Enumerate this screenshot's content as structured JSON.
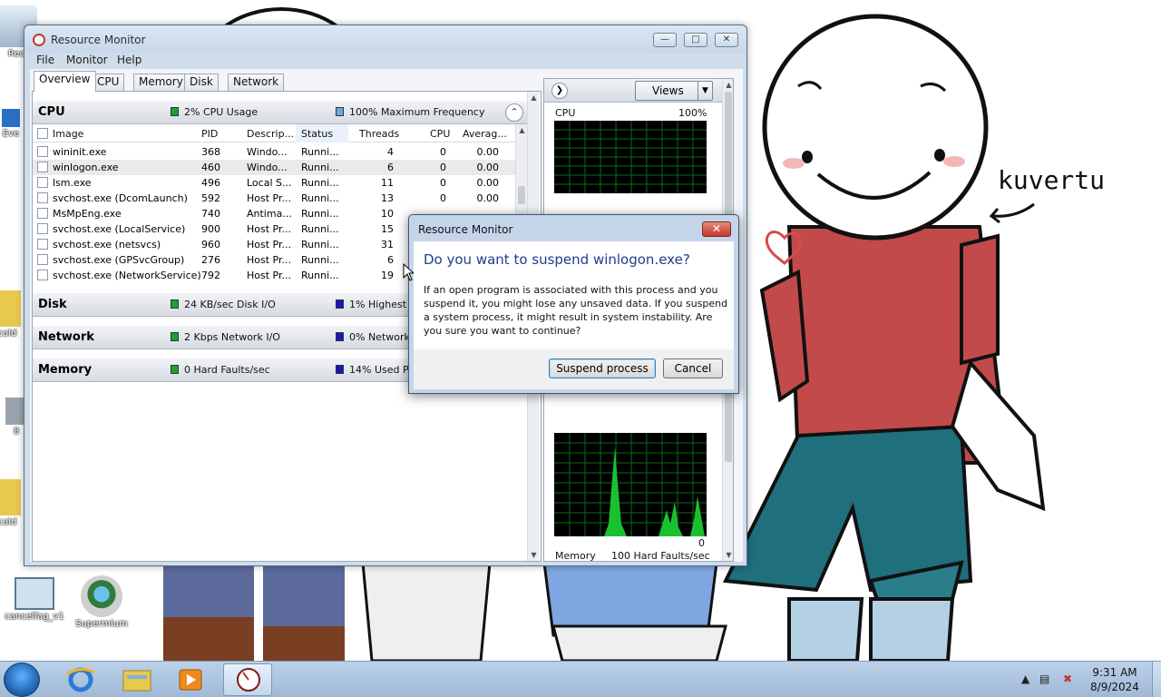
{
  "desktop": {
    "icons": [
      {
        "label": "Rec"
      },
      {
        "label": "Eve"
      },
      {
        "label": "cald"
      },
      {
        "label": "8"
      },
      {
        "label": "cald"
      },
      {
        "label": "cancelfag_v1"
      },
      {
        "label": "Supermium"
      }
    ],
    "wallpaper_text": "kuvertu"
  },
  "window": {
    "title": "Resource Monitor",
    "menu": [
      "File",
      "Monitor",
      "Help"
    ],
    "tabs": [
      "Overview",
      "CPU",
      "Memory",
      "Disk",
      "Network"
    ],
    "active_tab": "Overview",
    "cpu": {
      "title": "CPU",
      "stat1": "2% CPU Usage",
      "stat2": "100% Maximum Frequency",
      "columns": [
        "Image",
        "PID",
        "Descrip...",
        "Status",
        "Threads",
        "CPU",
        "Averag..."
      ],
      "rows": [
        {
          "image": "wininit.exe",
          "pid": "368",
          "desc": "Windo...",
          "status": "Runni...",
          "threads": "4",
          "cpu": "0",
          "avg": "0.00",
          "selected": false
        },
        {
          "image": "winlogon.exe",
          "pid": "460",
          "desc": "Windo...",
          "status": "Runni...",
          "threads": "6",
          "cpu": "0",
          "avg": "0.00",
          "selected": true
        },
        {
          "image": "lsm.exe",
          "pid": "496",
          "desc": "Local S...",
          "status": "Runni...",
          "threads": "11",
          "cpu": "0",
          "avg": "0.00",
          "selected": false
        },
        {
          "image": "svchost.exe (DcomLaunch)",
          "pid": "592",
          "desc": "Host Pr...",
          "status": "Runni...",
          "threads": "13",
          "cpu": "0",
          "avg": "0.00",
          "selected": false
        },
        {
          "image": "MsMpEng.exe",
          "pid": "740",
          "desc": "Antima...",
          "status": "Runni...",
          "threads": "10",
          "cpu": "",
          "avg": "",
          "selected": false
        },
        {
          "image": "svchost.exe (LocalService)",
          "pid": "900",
          "desc": "Host Pr...",
          "status": "Runni...",
          "threads": "15",
          "cpu": "",
          "avg": "",
          "selected": false
        },
        {
          "image": "svchost.exe (netsvcs)",
          "pid": "960",
          "desc": "Host Pr...",
          "status": "Runni...",
          "threads": "31",
          "cpu": "",
          "avg": "",
          "selected": false
        },
        {
          "image": "svchost.exe (GPSvcGroup)",
          "pid": "276",
          "desc": "Host Pr...",
          "status": "Runni...",
          "threads": "6",
          "cpu": "",
          "avg": "",
          "selected": false
        },
        {
          "image": "svchost.exe (NetworkService)",
          "pid": "792",
          "desc": "Host Pr...",
          "status": "Runni...",
          "threads": "19",
          "cpu": "",
          "avg": "",
          "selected": false
        }
      ]
    },
    "disk": {
      "title": "Disk",
      "stat1": "24 KB/sec Disk I/O",
      "stat2": "1% Highest A"
    },
    "network": {
      "title": "Network",
      "stat1": "2 Kbps Network I/O",
      "stat2": "0% Network"
    },
    "memory": {
      "title": "Memory",
      "stat1": "0 Hard Faults/sec",
      "stat2": "14% Used Ph"
    },
    "right_pane": {
      "views_label": "Views",
      "cpu_graph_label": "CPU",
      "cpu_graph_max": "100%",
      "network_graph_min": "0",
      "memory_graph_label": "Memory",
      "memory_graph_max": "100 Hard Faults/sec"
    }
  },
  "dialog": {
    "title": "Resource Monitor",
    "close_glyph": "✕",
    "question": "Do you want to suspend winlogon.exe?",
    "message": "If an open program is associated with this process and you suspend it, you might lose any unsaved data. If you suspend a system process, it might result in system instability. Are you sure you want to continue?",
    "primary_button": "Suspend process",
    "cancel_button": "Cancel"
  },
  "taskbar": {
    "time": "9:31 AM",
    "date": "8/9/2024"
  }
}
